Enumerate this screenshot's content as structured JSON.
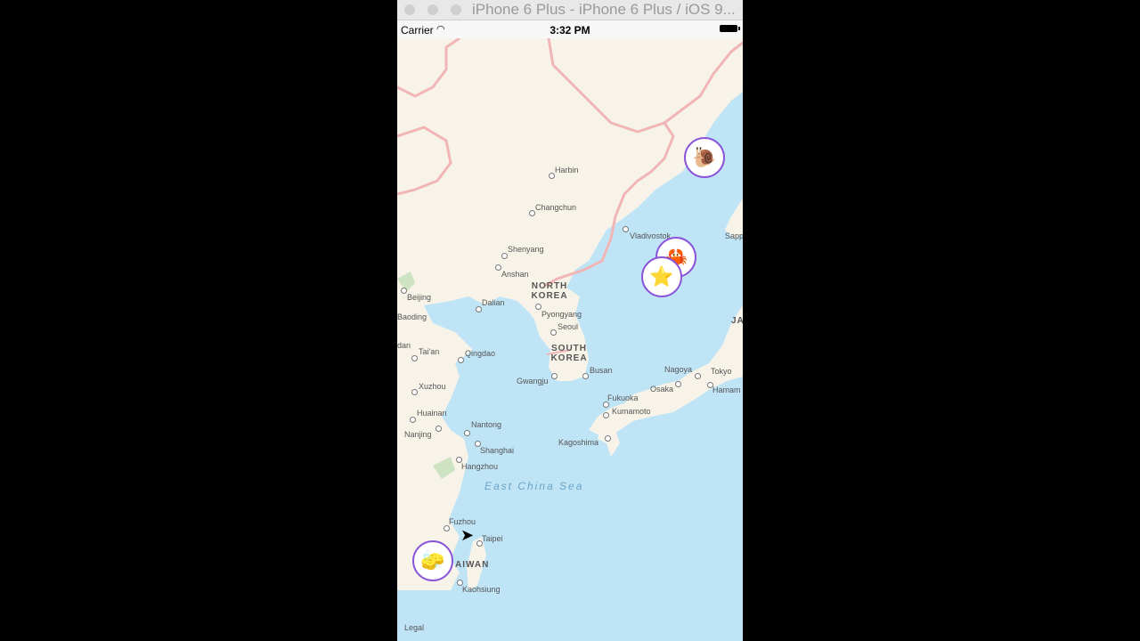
{
  "window": {
    "title": "iPhone 6 Plus - iPhone 6 Plus / iOS 9..."
  },
  "status": {
    "carrier": "Carrier",
    "time": "3:32 PM",
    "wifi_icon": "wifi-icon",
    "battery_icon": "battery-icon"
  },
  "map": {
    "cities": [
      {
        "id": "harbin",
        "name": "Harbin"
      },
      {
        "id": "changchun",
        "name": "Changchun"
      },
      {
        "id": "vladivostok",
        "name": "Vladivostok"
      },
      {
        "id": "sapporo",
        "name": "Sapp"
      },
      {
        "id": "shenyang",
        "name": "Shenyang"
      },
      {
        "id": "anshan",
        "name": "Anshan"
      },
      {
        "id": "beijing",
        "name": "Beijing"
      },
      {
        "id": "baoding",
        "name": "Baoding"
      },
      {
        "id": "dalian",
        "name": "Dalian"
      },
      {
        "id": "pyongyang",
        "name": "Pyongyang"
      },
      {
        "id": "seoul",
        "name": "Seoul"
      },
      {
        "id": "dan",
        "name": "dan"
      },
      {
        "id": "taian",
        "name": "Tai'an"
      },
      {
        "id": "qingdao",
        "name": "Qingdao"
      },
      {
        "id": "busan",
        "name": "Busan"
      },
      {
        "id": "gwangju",
        "name": "Gwangju"
      },
      {
        "id": "nagoya",
        "name": "Nagoya"
      },
      {
        "id": "tokyo",
        "name": "Tokyo"
      },
      {
        "id": "osaka",
        "name": "Osaka"
      },
      {
        "id": "hamam",
        "name": "Hamam"
      },
      {
        "id": "xuzhou",
        "name": "Xuzhou"
      },
      {
        "id": "fukuoka",
        "name": "Fukuoka"
      },
      {
        "id": "kumamoto",
        "name": "Kumamoto"
      },
      {
        "id": "huainan",
        "name": "Huainan"
      },
      {
        "id": "nantong",
        "name": "Nantong"
      },
      {
        "id": "nanjing",
        "name": "Nanjing"
      },
      {
        "id": "kagoshima",
        "name": "Kagoshima"
      },
      {
        "id": "shanghai",
        "name": "Shanghai"
      },
      {
        "id": "hangzhou",
        "name": "Hangzhou"
      },
      {
        "id": "fuzhou",
        "name": "Fuzhou"
      },
      {
        "id": "taipei",
        "name": "Taipei"
      },
      {
        "id": "kaohsiung",
        "name": "Kaohsiung"
      }
    ],
    "countries": [
      {
        "id": "north-korea",
        "name": "NORTH KOREA"
      },
      {
        "id": "south-korea",
        "name": "SOUTH KOREA"
      },
      {
        "id": "taiwan",
        "name": "AIWAN"
      },
      {
        "id": "japan",
        "name": "JA"
      }
    ],
    "seas": [
      {
        "id": "east-china-sea",
        "name": "East China Sea"
      }
    ],
    "legal": "Legal",
    "pins": [
      {
        "id": "gary",
        "icon": "snail-character-icon",
        "glyph": "🐌"
      },
      {
        "id": "plankton",
        "icon": "crab-character-icon",
        "glyph": "🦀"
      },
      {
        "id": "patrick",
        "icon": "starfish-character-icon",
        "glyph": "⭐"
      },
      {
        "id": "spongebob",
        "icon": "sponge-character-icon",
        "glyph": "🧽"
      }
    ]
  }
}
